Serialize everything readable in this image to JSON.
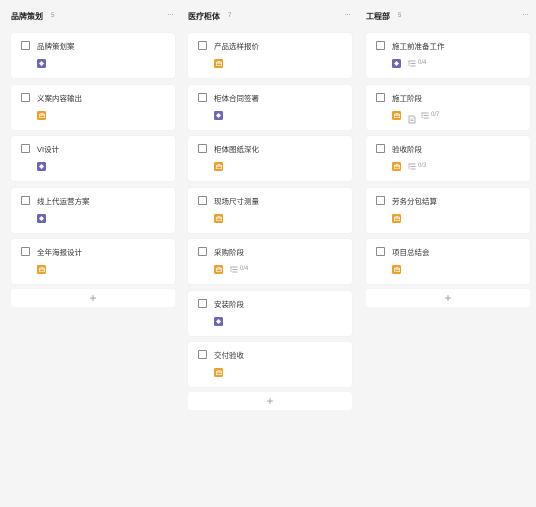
{
  "columns": [
    {
      "title": "品牌策划",
      "count": "5",
      "more": "···",
      "add": "+",
      "cards": [
        {
          "title": "品牌策划案",
          "tag": "purple"
        },
        {
          "title": "义案内容输出",
          "tag": "orange"
        },
        {
          "title": "VI设计",
          "tag": "purple"
        },
        {
          "title": "线上代运营方案",
          "tag": "purple"
        },
        {
          "title": "全年海报设计",
          "tag": "orange"
        }
      ]
    },
    {
      "title": "医疗柜体",
      "count": "7",
      "more": "···",
      "add": "+",
      "cards": [
        {
          "title": "产品选样报价",
          "tag": "orange"
        },
        {
          "title": "柜体合同签署",
          "tag": "purple"
        },
        {
          "title": "柜体图纸深化",
          "tag": "orange"
        },
        {
          "title": "现场尺寸测量",
          "tag": "orange"
        },
        {
          "title": "采购阶段",
          "tag": "orange",
          "subtasks": "0/4"
        },
        {
          "title": "安装阶段",
          "tag": "purple"
        },
        {
          "title": "交付验收",
          "tag": "orange"
        }
      ]
    },
    {
      "title": "工程部",
      "count": "5",
      "more": "···",
      "add": "+",
      "cards": [
        {
          "title": "施工前准备工作",
          "tag": "purple",
          "subtasks": "0/4"
        },
        {
          "title": "施工阶段",
          "tag": "orange",
          "note": true,
          "subtasks": "0/7"
        },
        {
          "title": "验收阶段",
          "tag": "orange",
          "subtasks": "0/3"
        },
        {
          "title": "劳务分包结算",
          "tag": "orange"
        },
        {
          "title": "项目总结会",
          "tag": "orange"
        }
      ]
    }
  ],
  "colors": {
    "purple": "#6b66b8",
    "orange": "#f0a028",
    "background": "#f5f5f5"
  },
  "icons": {
    "purple_tag": "diamond-icon",
    "orange_tag": "briefcase-icon",
    "subtasks": "subtask-list-icon",
    "note": "note-icon",
    "more": "more-dots-icon",
    "add": "plus-icon"
  }
}
